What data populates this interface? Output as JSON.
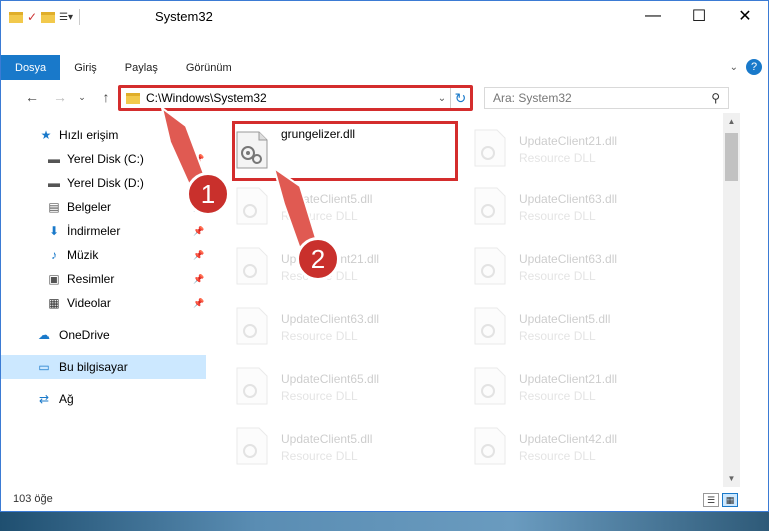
{
  "window": {
    "title": "System32",
    "controls": {
      "minimize": "—",
      "maximize": "☐",
      "close": "✕"
    }
  },
  "ribbon": {
    "tabs": [
      "Dosya",
      "Giriş",
      "Paylaş",
      "Görünüm"
    ]
  },
  "navbar": {
    "address": "C:\\Windows\\System32",
    "search_placeholder": "Ara: System32"
  },
  "sidebar": {
    "items": [
      {
        "label": "Hızlı erişim",
        "icon": "star-icon"
      },
      {
        "label": "Yerel Disk (C:)",
        "icon": "drive-icon"
      },
      {
        "label": "Yerel Disk (D:)",
        "icon": "drive-icon"
      },
      {
        "label": "Belgeler",
        "icon": "documents-icon"
      },
      {
        "label": "İndirmeler",
        "icon": "download-icon"
      },
      {
        "label": "Müzik",
        "icon": "music-icon"
      },
      {
        "label": "Resimler",
        "icon": "pictures-icon"
      },
      {
        "label": "Videolar",
        "icon": "video-icon"
      },
      {
        "label": "OneDrive",
        "icon": "cloud-icon"
      },
      {
        "label": "Bu bilgisayar",
        "icon": "computer-icon"
      },
      {
        "label": "Ağ",
        "icon": "network-icon"
      }
    ]
  },
  "files": {
    "selected": {
      "name": "grungelizer.dll"
    },
    "tiles": [
      {
        "name": "UpdateClient21.dll",
        "type": "Resource DLL"
      },
      {
        "name": "UpdateClient5.dll",
        "type": "Resource DLL"
      },
      {
        "name": "UpdateClient63.dll",
        "type": "Resource DLL"
      },
      {
        "name": "UpdateClient21.dll",
        "type": "Resource DLL"
      },
      {
        "name": "UpdateClient63.dll",
        "type": "Resource DLL"
      },
      {
        "name": "UpdateClient63.dll",
        "type": "Resource DLL"
      },
      {
        "name": "UpdateClient5.dll",
        "type": "Resource DLL"
      },
      {
        "name": "UpdateClient65.dll",
        "type": "Resource DLL"
      },
      {
        "name": "UpdateClient21.dll",
        "type": "Resource DLL"
      },
      {
        "name": "UpdateClient5.dll",
        "type": "Resource DLL"
      },
      {
        "name": "UpdateClient42.dll",
        "type": "Resource DLL"
      }
    ]
  },
  "status": {
    "count": "103 öğe"
  },
  "annotations": {
    "badge1": "1",
    "badge2": "2"
  },
  "colors": {
    "accent": "#1979ca",
    "highlight": "#d42d2d",
    "selection": "#cce8ff"
  }
}
